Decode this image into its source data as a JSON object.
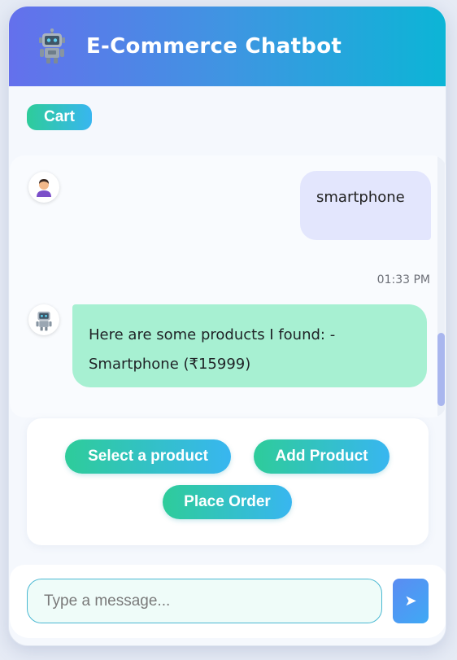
{
  "header": {
    "title": "E-Commerce Chatbot",
    "icon": "robot-icon"
  },
  "cart": {
    "label": "Cart"
  },
  "messages": [
    {
      "sender": "user",
      "text": "smartphone",
      "avatar": "user-avatar-icon"
    },
    {
      "sender": "bot",
      "text": "Here are some products I found: - Smartphone (₹15999)",
      "avatar": "robot-icon"
    }
  ],
  "timestamp": "01:33 PM",
  "actions": {
    "select_product": "Select a product",
    "add_product": "Add Product",
    "place_order": "Place Order"
  },
  "composer": {
    "placeholder": "Type a message...",
    "send_icon": "send-icon"
  },
  "colors": {
    "header_gradient_start": "#6470ec",
    "header_gradient_end": "#0cb5d6",
    "button_gradient_start": "#2ecc9a",
    "button_gradient_end": "#38b6f0",
    "user_bubble": "#e3e6fd",
    "bot_bubble": "#a7f0d2"
  }
}
